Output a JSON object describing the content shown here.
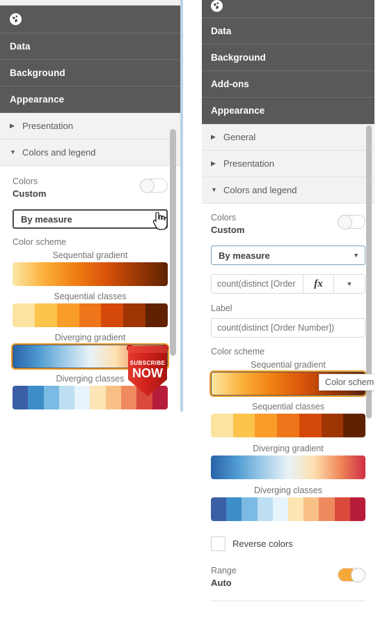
{
  "left_panel": {
    "header_icon": "globe-icon",
    "accordion_dark": [
      {
        "label": "Data"
      },
      {
        "label": "Background"
      },
      {
        "label": "Appearance"
      }
    ],
    "accordion_light": [
      {
        "label": "Presentation",
        "state": "collapsed"
      },
      {
        "label": "Colors and legend",
        "state": "expanded"
      }
    ],
    "colors": {
      "label": "Colors",
      "value": "Custom",
      "toggle_state": "off"
    },
    "mode_select": {
      "value": "By measure",
      "arrow": "chevron-down-icon"
    },
    "color_scheme": {
      "label": "Color scheme",
      "options": [
        {
          "caption": "Sequential gradient",
          "type": "gradient",
          "selected": false
        },
        {
          "caption": "Sequential classes",
          "type": "classes",
          "selected": false
        },
        {
          "caption": "Diverging gradient",
          "type": "gradient",
          "selected": true
        },
        {
          "caption": "Diverging classes",
          "type": "classes",
          "selected": false
        }
      ]
    },
    "overlay_badge": {
      "line1": "SUBSCRIBE",
      "line2": "NOW"
    }
  },
  "right_panel": {
    "header_icon": "globe-icon",
    "accordion_dark": [
      {
        "label": "Data"
      },
      {
        "label": "Background"
      },
      {
        "label": "Add-ons"
      },
      {
        "label": "Appearance"
      }
    ],
    "accordion_light": [
      {
        "label": "General",
        "state": "collapsed"
      },
      {
        "label": "Presentation",
        "state": "collapsed"
      },
      {
        "label": "Colors and legend",
        "state": "expanded"
      }
    ],
    "colors": {
      "label": "Colors",
      "value": "Custom",
      "toggle_state": "off"
    },
    "mode_select": {
      "value": "By measure",
      "arrow": "chevron-down-icon"
    },
    "measure_field": {
      "value": "count(distinct [Order",
      "fx_label": "fx",
      "arrow": "chevron-down-icon"
    },
    "label_field": {
      "label": "Label",
      "value": "count(distinct [Order Number])"
    },
    "color_scheme": {
      "label": "Color scheme",
      "tooltip": "Color scheme",
      "options": [
        {
          "caption": "Sequential gradient",
          "type": "gradient",
          "selected": true
        },
        {
          "caption": "Sequential classes",
          "type": "classes",
          "selected": false
        },
        {
          "caption": "Diverging gradient",
          "type": "gradient",
          "selected": false
        },
        {
          "caption": "Diverging classes",
          "type": "classes",
          "selected": false
        }
      ]
    },
    "reverse_colors": {
      "label": "Reverse colors",
      "checked": false
    },
    "range": {
      "label": "Range",
      "value": "Auto",
      "toggle_state": "on"
    }
  },
  "palettes": {
    "sequential_gradient": [
      "#fde8a8",
      "#fbb03b",
      "#f07f13",
      "#d9530a",
      "#9c3803",
      "#5e2202"
    ],
    "sequential_classes": [
      "#fce3a0",
      "#fcc44c",
      "#fa9c28",
      "#ee7519",
      "#d4490a",
      "#9e3503",
      "#5f2100"
    ],
    "diverging_gradient": [
      "#2a62a8",
      "#4e9ad0",
      "#9ecae8",
      "#e8f2f8",
      "#fde0b0",
      "#f0895a",
      "#cf2f44"
    ],
    "diverging_classes": [
      "#3b5fa5",
      "#3d8dc9",
      "#7bbae3",
      "#bedff2",
      "#e8f4fb",
      "#fde5b4",
      "#f8c085",
      "#ef8a5f",
      "#da4a3c",
      "#b71d3a"
    ]
  },
  "accent_colors": {
    "panel_dark": "#595959",
    "panel_light": "#f2f2f2",
    "panel_border_blue": "#b9d3e6",
    "toggle_on": "#f6a93b",
    "select_focus_border": "#4a4a4a",
    "select_border": "#7ea3b8",
    "badge_red": "#d92b2b",
    "scrollbar": "#bdbdbd"
  }
}
